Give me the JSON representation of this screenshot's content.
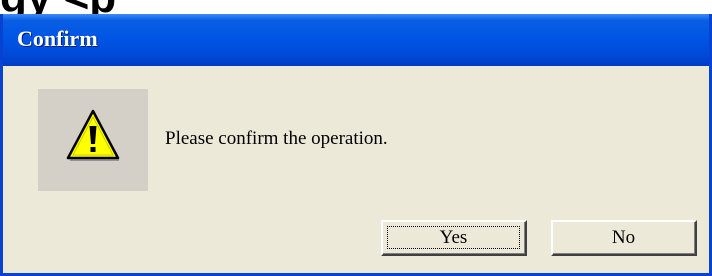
{
  "background": {
    "heading_fragment": "gy <p"
  },
  "dialog": {
    "title": "Confirm",
    "message": "Please confirm the operation.",
    "icon": "warning-icon",
    "buttons": {
      "yes_label": "Yes",
      "no_label": "No"
    },
    "colors": {
      "titlebar": "#0055e5",
      "frame": "#0842d2",
      "body": "#ece9d8",
      "icon_panel": "#d4d0c8",
      "warning_fill": "#ffff00"
    }
  }
}
